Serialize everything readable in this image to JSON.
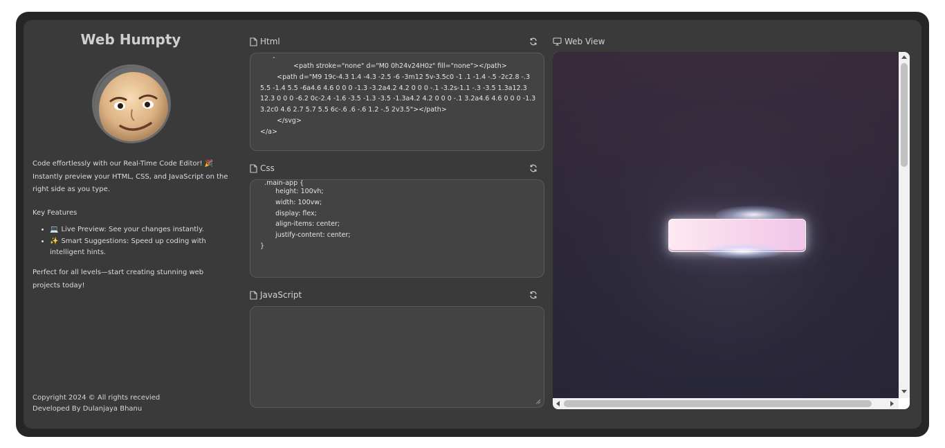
{
  "sidebar": {
    "title": "Web Humpty",
    "description_line1": "Code effortlessly with our Real-Time Code Editor! 🎉",
    "description_line2": "Instantly preview your HTML, CSS, and JavaScript on the right side as you type.",
    "features_title": "Key Features",
    "features": [
      {
        "emoji": "💻",
        "text": "Live Preview: See your changes instantly."
      },
      {
        "emoji": "✨",
        "text": "Smart Suggestions: Speed up coding with intelligent hints."
      }
    ],
    "tagline": "Perfect for all levels—start creating stunning web projects today!",
    "footer_copyright": "Copyright 2024 © All rights recevied",
    "footer_developer": "Developed By Dulanjaya Bhanu"
  },
  "panels": {
    "html": {
      "label": "Html",
      "code": [
        "      -",
        "        <path stroke=\"none\" d=\"M0 0h24v24H0z\" fill=\"none\"></path>",
        "        <path d=\"M9 19c-4.3 1.4 -4.3 -2.5 -6 -3m12 5v-3.5c0 -1 .1 -1.4 -.5 -2c2.8 -.3 5.5 -1.4 5.5 -6a4.6 4.6 0 0 0 -1.3 -3.2a4.2 4.2 0 0 0 -.1 -3.2s-1.1 -.3 -3.5 1.3a12.3 12.3 0 0 0 -6.2 0c-2.4 -1.6 -3.5 -1.3 -3.5 -1.3a4.2 4.2 0 0 0 -.1 3.2a4.6 4.6 0 0 0 -1.3 3.2c0 4.6 2.7 5.7 5.5 6c-.6 .6 -.6 1.2 -.5 2v3.5\"></path>",
        "    </svg>",
        "</a>"
      ]
    },
    "css": {
      "label": "Css",
      "code": [
        "  .main-app {",
        "    height: 100vh;",
        "    width: 100vw;",
        "    display: flex;",
        "    align-items: center;",
        "    justify-content: center;",
        "}"
      ]
    },
    "javascript": {
      "label": "JavaScript",
      "code": []
    },
    "webview": {
      "label": "Web View"
    }
  },
  "icons": {
    "file": "file-icon",
    "refresh": "refresh-icon",
    "monitor": "monitor-icon"
  },
  "colors": {
    "background": "#3a3a3a",
    "frame": "#262626",
    "editor": "#434343",
    "preview_bg": "#2e2a3a"
  }
}
